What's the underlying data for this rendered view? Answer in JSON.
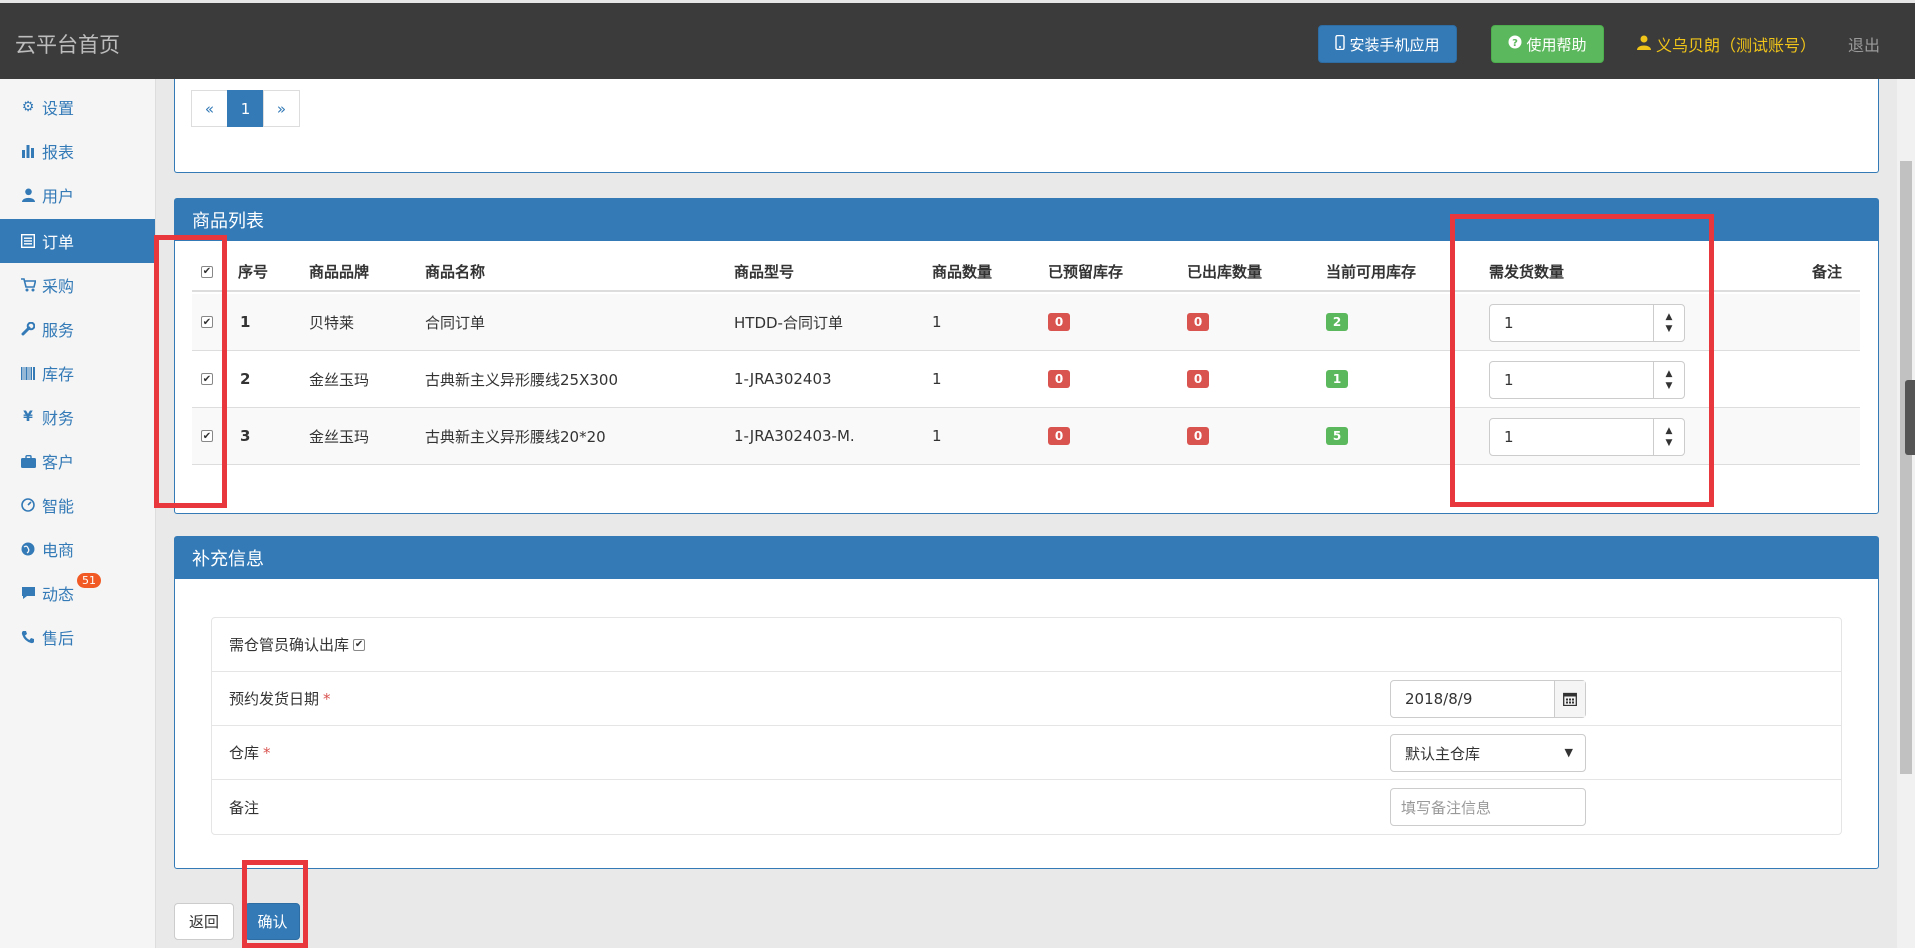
{
  "header": {
    "brand": "云平台首页",
    "install_app": "安装手机应用",
    "help": "使用帮助",
    "user": "义乌贝朗（测试账号）",
    "logout": "退出"
  },
  "sidebar": {
    "items": [
      {
        "label": "设置",
        "icon": "gear-icon"
      },
      {
        "label": "报表",
        "icon": "bar-chart-icon"
      },
      {
        "label": "用户",
        "icon": "user-icon"
      },
      {
        "label": "订单",
        "icon": "list-alt-icon"
      },
      {
        "label": "采购",
        "icon": "shopping-cart-icon"
      },
      {
        "label": "服务",
        "icon": "wrench-icon"
      },
      {
        "label": "库存",
        "icon": "barcode-icon"
      },
      {
        "label": "财务",
        "icon": "yen-icon"
      },
      {
        "label": "客户",
        "icon": "briefcase-icon"
      },
      {
        "label": "智能",
        "icon": "dashboard-icon"
      },
      {
        "label": "电商",
        "icon": "globe-icon"
      },
      {
        "label": "动态",
        "icon": "comment-icon"
      },
      {
        "label": "售后",
        "icon": "phone-icon"
      }
    ],
    "active": "订单",
    "dynamic_badge": "51"
  },
  "pagination": {
    "prev": "«",
    "current": "1",
    "next": "»"
  },
  "products": {
    "title": "商品列表",
    "headers": {
      "index": "序号",
      "brand": "商品品牌",
      "name": "商品名称",
      "model": "商品型号",
      "qty": "商品数量",
      "reserved": "已预留库存",
      "shipped": "已出库数量",
      "available": "当前可用库存",
      "to_ship": "需发货数量",
      "note": "备注"
    },
    "rows": [
      {
        "index": "1",
        "brand": "贝特莱",
        "name": "合同订单",
        "model": "HTDD-合同订单",
        "qty": "1",
        "reserved": "0",
        "shipped": "0",
        "available": "2",
        "to_ship": "1"
      },
      {
        "index": "2",
        "brand": "金丝玉玛",
        "name": "古典新主义异形腰线25X300",
        "model": "1-JRA302403",
        "qty": "1",
        "reserved": "0",
        "shipped": "0",
        "available": "1",
        "to_ship": "1"
      },
      {
        "index": "3",
        "brand": "金丝玉玛",
        "name": "古典新主义异形腰线20*20",
        "model": "1-JRA302403-M.",
        "qty": "1",
        "reserved": "0",
        "shipped": "0",
        "available": "5",
        "to_ship": "1"
      }
    ]
  },
  "extra": {
    "title": "补充信息",
    "confirm_label": "需仓管员确认出库",
    "date_label": "预约发货日期",
    "date_value": "2018/8/9",
    "warehouse_label": "仓库",
    "warehouse_value": "默认主仓库",
    "note_label": "备注",
    "note_placeholder": "填写备注信息",
    "required_mark": "*"
  },
  "actions": {
    "back": "返回",
    "confirm": "确认"
  },
  "colors": {
    "primary": "#337ab7",
    "success": "#5cb85c",
    "danger": "#d9534f",
    "highlight": "#e8383d"
  }
}
